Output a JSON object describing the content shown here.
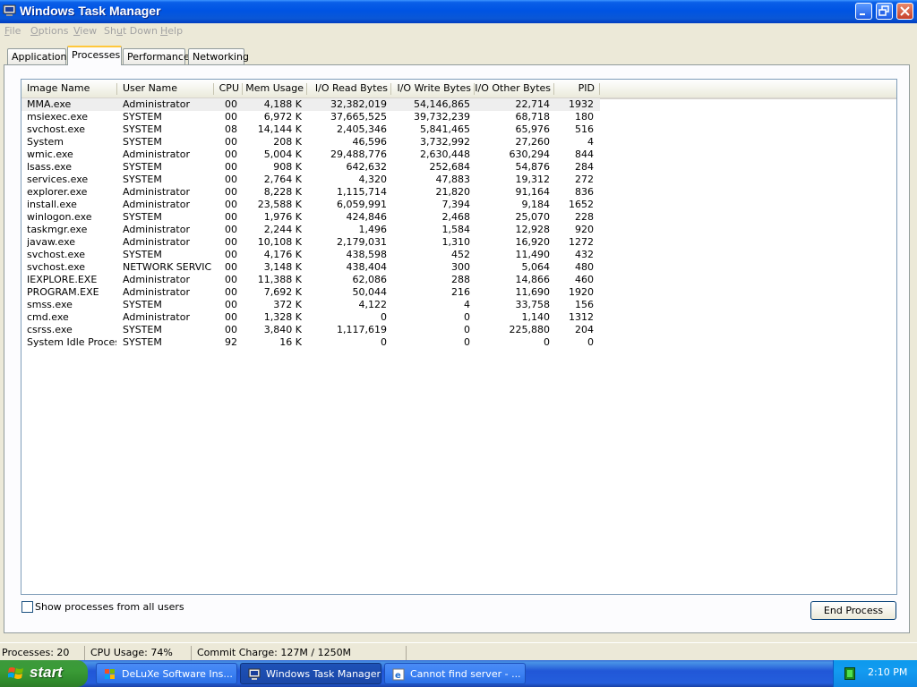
{
  "window": {
    "title": "Windows Task Manager"
  },
  "menubar": {
    "items": [
      "File",
      "Options",
      "View",
      "Shut Down",
      "Help"
    ]
  },
  "tabs": [
    {
      "label": "Applications",
      "active": false
    },
    {
      "label": "Processes",
      "active": true
    },
    {
      "label": "Performance",
      "active": false
    },
    {
      "label": "Networking",
      "active": false
    }
  ],
  "processes": {
    "columns": [
      "Image Name",
      "User Name",
      "CPU",
      "Mem Usage",
      "I/O Read Bytes",
      "I/O Write Bytes",
      "I/O Other Bytes",
      "PID"
    ],
    "rows": [
      [
        "MMA.exe",
        "Administrator",
        "00",
        "4,188 K",
        "32,382,019",
        "54,146,865",
        "22,714",
        "1932"
      ],
      [
        "msiexec.exe",
        "SYSTEM",
        "00",
        "6,972 K",
        "37,665,525",
        "39,732,239",
        "68,718",
        "180"
      ],
      [
        "svchost.exe",
        "SYSTEM",
        "08",
        "14,144 K",
        "2,405,346",
        "5,841,465",
        "65,976",
        "516"
      ],
      [
        "System",
        "SYSTEM",
        "00",
        "208 K",
        "46,596",
        "3,732,992",
        "27,260",
        "4"
      ],
      [
        "wmic.exe",
        "Administrator",
        "00",
        "5,004 K",
        "29,488,776",
        "2,630,448",
        "630,294",
        "844"
      ],
      [
        "lsass.exe",
        "SYSTEM",
        "00",
        "908 K",
        "642,632",
        "252,684",
        "54,876",
        "284"
      ],
      [
        "services.exe",
        "SYSTEM",
        "00",
        "2,764 K",
        "4,320",
        "47,883",
        "19,312",
        "272"
      ],
      [
        "explorer.exe",
        "Administrator",
        "00",
        "8,228 K",
        "1,115,714",
        "21,820",
        "91,164",
        "836"
      ],
      [
        "install.exe",
        "Administrator",
        "00",
        "23,588 K",
        "6,059,991",
        "7,394",
        "9,184",
        "1652"
      ],
      [
        "winlogon.exe",
        "SYSTEM",
        "00",
        "1,976 K",
        "424,846",
        "2,468",
        "25,070",
        "228"
      ],
      [
        "taskmgr.exe",
        "Administrator",
        "00",
        "2,244 K",
        "1,496",
        "1,584",
        "12,928",
        "920"
      ],
      [
        "javaw.exe",
        "Administrator",
        "00",
        "10,108 K",
        "2,179,031",
        "1,310",
        "16,920",
        "1272"
      ],
      [
        "svchost.exe",
        "SYSTEM",
        "00",
        "4,176 K",
        "438,598",
        "452",
        "11,490",
        "432"
      ],
      [
        "svchost.exe",
        "NETWORK SERVICE",
        "00",
        "3,148 K",
        "438,404",
        "300",
        "5,064",
        "480"
      ],
      [
        "IEXPLORE.EXE",
        "Administrator",
        "00",
        "11,388 K",
        "62,086",
        "288",
        "14,866",
        "460"
      ],
      [
        "PROGRAM.EXE",
        "Administrator",
        "00",
        "7,692 K",
        "50,044",
        "216",
        "11,690",
        "1920"
      ],
      [
        "smss.exe",
        "SYSTEM",
        "00",
        "372 K",
        "4,122",
        "4",
        "33,758",
        "156"
      ],
      [
        "cmd.exe",
        "Administrator",
        "00",
        "1,328 K",
        "0",
        "0",
        "1,140",
        "1312"
      ],
      [
        "csrss.exe",
        "SYSTEM",
        "00",
        "3,840 K",
        "1,117,619",
        "0",
        "225,880",
        "204"
      ],
      [
        "System Idle Process",
        "SYSTEM",
        "92",
        "16 K",
        "0",
        "0",
        "0",
        "0"
      ]
    ]
  },
  "footer": {
    "show_all_users_label": "Show processes from all users",
    "show_all_users_checked": false,
    "end_process_label": "End Process"
  },
  "statusbar": {
    "processes": "Processes: 20",
    "cpu": "CPU Usage: 74%",
    "commit": "Commit Charge: 127M / 1250M"
  },
  "taskbar": {
    "start_label": "start",
    "buttons": [
      {
        "label": "DeLuXe Software Ins...",
        "active": false
      },
      {
        "label": "Windows Task Manager",
        "active": true
      },
      {
        "label": "Cannot find server - ...",
        "active": false
      }
    ],
    "clock": "2:10 PM"
  },
  "colors": {
    "title_bar": "#0054e3",
    "taskbar": "#245edc",
    "start_button": "#3a9b36",
    "window_bg": "#ece9d8",
    "selected_row": "#eeeeee"
  }
}
